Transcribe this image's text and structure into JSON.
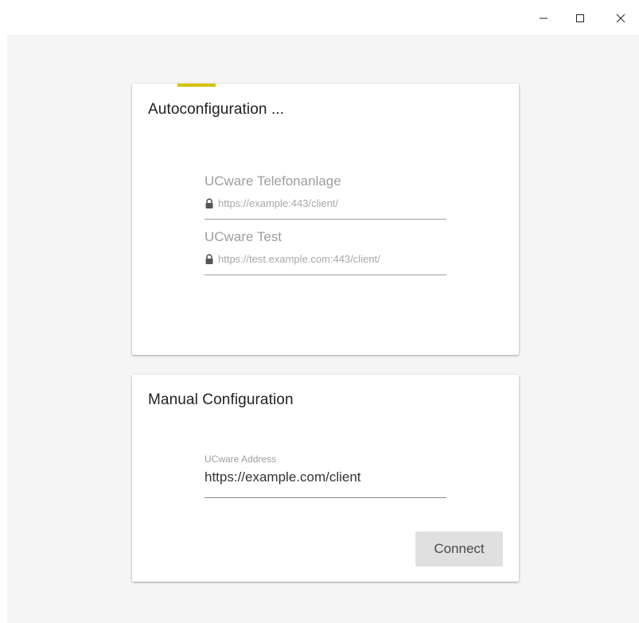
{
  "window": {
    "controls": {
      "minimize_icon": "minimize-icon",
      "maximize_icon": "maximize-icon",
      "close_icon": "close-icon"
    }
  },
  "colors": {
    "accent": "#d4c200",
    "background": "#f5f5f5",
    "card": "#ffffff",
    "button": "#e0e0e0"
  },
  "autoconfig": {
    "title": "Autoconfiguration ...",
    "servers": [
      {
        "name": "UCware Telefonanlage",
        "url": "https://example:443/client/",
        "icon": "lock-icon"
      },
      {
        "name": "UCware Test",
        "url": "https://test.example.com:443/client/",
        "icon": "lock-icon"
      }
    ]
  },
  "manual": {
    "title": "Manual Configuration",
    "address_label": "UCware Address",
    "address_value": "https://example.com/client",
    "connect_label": "Connect"
  }
}
